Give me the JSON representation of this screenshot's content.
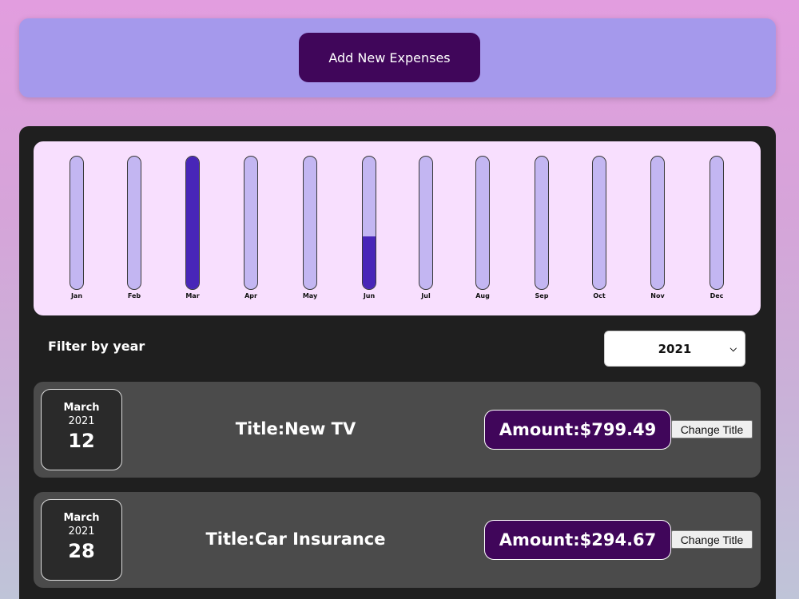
{
  "header": {
    "add_button_label": "Add New Expenses"
  },
  "chart_data": {
    "type": "bar",
    "categories": [
      "Jan",
      "Feb",
      "Mar",
      "Apr",
      "May",
      "Jun",
      "Jul",
      "Aug",
      "Sep",
      "Oct",
      "Nov",
      "Dec"
    ],
    "fill_fractions": [
      0,
      0,
      1.0,
      0,
      0,
      0.4,
      0,
      0,
      0,
      0,
      0,
      0
    ],
    "colors": {
      "track": "#c3b6f2",
      "fill": "#4826b8"
    }
  },
  "filter": {
    "label": "Filter by year",
    "selected_year": "2021"
  },
  "expenses": [
    {
      "month": "March",
      "year": "2021",
      "day": "12",
      "title": "Title:New TV",
      "amount": "Amount:$799.49",
      "change_label": "Change Title"
    },
    {
      "month": "March",
      "year": "2021",
      "day": "28",
      "title": "Title:Car Insurance",
      "amount": "Amount:$294.67",
      "change_label": "Change Title"
    }
  ],
  "colors": {
    "accent": "#40065a",
    "top_card": "#a599ec",
    "panel": "#1f1f1f",
    "item": "#4b4b4b"
  }
}
